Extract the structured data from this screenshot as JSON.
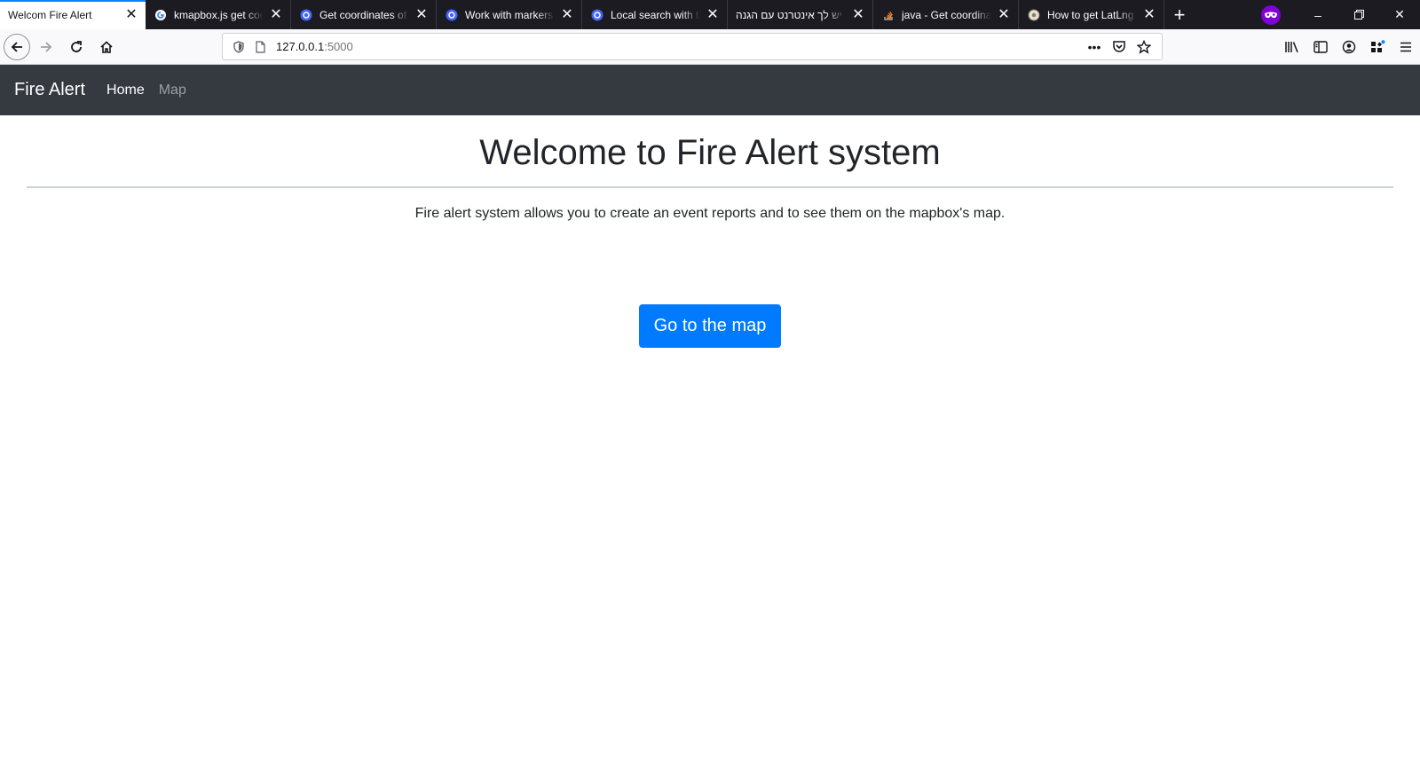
{
  "browser": {
    "tabs": [
      {
        "title": "Welcom Fire Alert",
        "active": true,
        "favicon": "none"
      },
      {
        "title": "kmapbox.js get coordinates",
        "favicon": "google-icon"
      },
      {
        "title": "Get coordinates of the",
        "favicon": "mapbox-icon"
      },
      {
        "title": "Work with markers in",
        "favicon": "mapbox-icon"
      },
      {
        "title": "Local search with the",
        "favicon": "mapbox-icon"
      },
      {
        "title": "יש לך אינטרנט עם הגנה",
        "favicon": "none"
      },
      {
        "title": "java - Get coordinates",
        "favicon": "stackoverflow-icon"
      },
      {
        "title": "How to get LatLng a",
        "favicon": "site-icon"
      }
    ],
    "url": {
      "host": "127.0.0.1",
      "port": ":5000"
    }
  },
  "site": {
    "brand": "Fire Alert",
    "nav": {
      "home": "Home",
      "map": "Map"
    },
    "title": "Welcome to Fire Alert system",
    "lead": "Fire alert system allows you to create an event reports and to see them on the mapbox's map.",
    "cta": "Go to the map"
  },
  "colors": {
    "accent": "#007bff",
    "navbar": "#343a40",
    "tabstrip": "#1c1b22",
    "active_tab_indicator": "#0a84ff",
    "private_mask": "#8000d7"
  }
}
